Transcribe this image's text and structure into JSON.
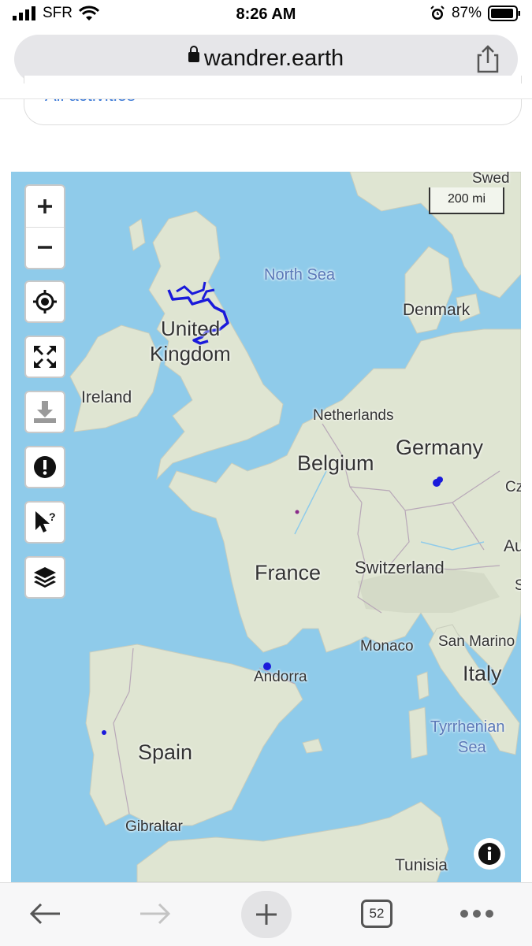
{
  "status_bar": {
    "carrier": "SFR",
    "time": "8:26 AM",
    "battery": "87%",
    "icons": [
      "signal-bars-icon",
      "wifi-icon",
      "alarm-icon",
      "battery-icon"
    ]
  },
  "browser": {
    "url": "wandrer.earth",
    "lock_icon": "lock-icon",
    "share_icon": "share-icon"
  },
  "activity_filter": {
    "selected": "All activities",
    "caret_icon": "chevron-down-icon"
  },
  "map": {
    "scale_label": "200 mi",
    "labels": {
      "north_sea": "North Sea",
      "denmark": "Denmark",
      "united_kingdom": "United Kingdom",
      "united": "United",
      "kingdom": "Kingdom",
      "ireland": "Ireland",
      "netherlands": "Netherlands",
      "germany": "Germany",
      "belgium": "Belgium",
      "france": "France",
      "switzerland": "Switzerland",
      "austria": "Austr",
      "slovenia": "Slov",
      "czech": "Cz",
      "sweden": "Swed",
      "monaco": "Monaco",
      "san_marino": "San Marino",
      "italy": "Italy",
      "andorra": "Andorra",
      "tyrrhenian": "Tyrrhenian",
      "sea": "Sea",
      "spain": "Spain",
      "gibraltar": "Gibraltar",
      "tunisia": "Tunisia"
    },
    "controls": [
      {
        "name": "zoom-in-button",
        "icon": "plus-icon"
      },
      {
        "name": "zoom-out-button",
        "icon": "minus-icon"
      },
      {
        "name": "locate-button",
        "icon": "crosshair-icon"
      },
      {
        "name": "fullscreen-button",
        "icon": "expand-arrows-icon"
      },
      {
        "name": "download-button",
        "icon": "download-icon"
      },
      {
        "name": "report-button",
        "icon": "exclamation-icon"
      },
      {
        "name": "identify-button",
        "icon": "cursor-question-icon"
      },
      {
        "name": "layers-button",
        "icon": "layers-icon"
      }
    ],
    "info_icon": "info-icon",
    "colors": {
      "sea": "#8fcbea",
      "land": "#dfe5d2",
      "route": "#1a1adb"
    }
  },
  "bottom_bar": {
    "tab_count": "52",
    "icons": [
      "back-arrow-icon",
      "forward-arrow-icon",
      "new-tab-plus-icon",
      "tabs-icon",
      "more-dots-icon"
    ]
  }
}
